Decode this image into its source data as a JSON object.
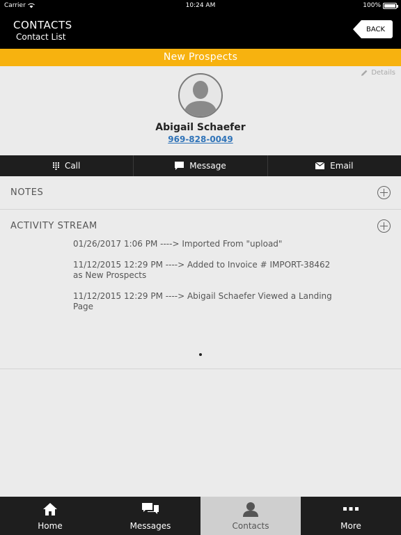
{
  "status": {
    "carrier": "Carrier",
    "time": "10:24 AM",
    "battery": "100%"
  },
  "nav": {
    "title": "CONTACTS",
    "subtitle": "Contact List",
    "back_label": "BACK"
  },
  "banner": {
    "label": "New Prospects",
    "color": "#f7b20f"
  },
  "profile": {
    "details_label": "Details",
    "name": "Abigail Schaefer",
    "phone": "969-828-0049"
  },
  "actions": [
    {
      "label": "Call",
      "icon": "keypad-icon"
    },
    {
      "label": "Message",
      "icon": "chat-bubble-icon"
    },
    {
      "label": "Email",
      "icon": "envelope-icon"
    }
  ],
  "notes": {
    "title": "NOTES"
  },
  "activity": {
    "title": "ACTIVITY STREAM",
    "items": [
      "01/26/2017 1:06 PM ----> Imported From \"upload\"",
      "11/12/2015 12:29 PM ----> Added to Invoice # IMPORT-38462 as New Prospects",
      "11/12/2015 12:29 PM ----> Abigail Schaefer Viewed a Landing Page"
    ]
  },
  "tabs": [
    {
      "label": "Home",
      "icon": "home-icon",
      "active": false
    },
    {
      "label": "Messages",
      "icon": "messages-icon",
      "active": false
    },
    {
      "label": "Contacts",
      "icon": "contact-person-icon",
      "active": true
    },
    {
      "label": "More",
      "icon": "more-dots-icon",
      "active": false
    }
  ]
}
